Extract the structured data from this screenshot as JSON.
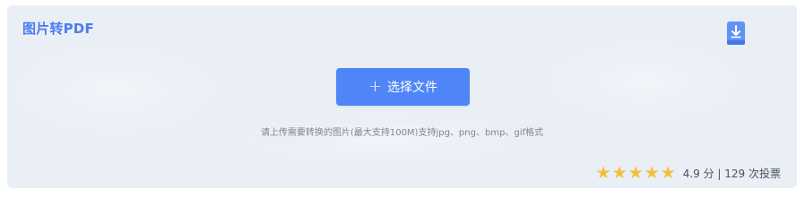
{
  "header": {
    "title": "图片转PDF"
  },
  "upload": {
    "button_label": "选择文件",
    "hint": "请上传需要转换的图片(最大支持100M)支持jpg、png、bmp、gif格式"
  },
  "rating": {
    "stars": [
      "★",
      "★",
      "★",
      "★",
      "★"
    ],
    "score_text": "4.9 分 | 129 次投票"
  },
  "icons": {
    "download": "download-icon",
    "plus": "plus-icon",
    "star": "star-icon"
  },
  "colors": {
    "accent": "#4f86f7",
    "title": "#4a7cf0",
    "background": "#eaeef5",
    "star": "#f7bd3a"
  }
}
